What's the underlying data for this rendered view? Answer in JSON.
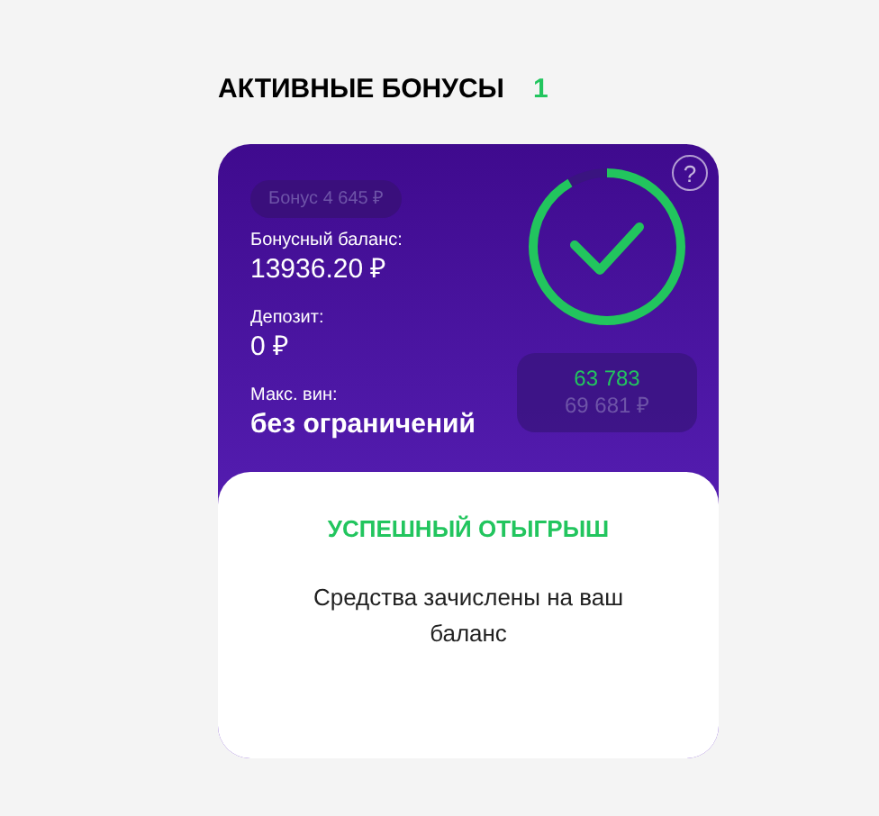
{
  "heading": {
    "title": "АКТИВНЫЕ БОНУСЫ",
    "count": "1"
  },
  "bonus_card": {
    "help": "?",
    "bonus_tag": "Бонус 4 645 ₽",
    "fields": [
      {
        "label": "Бонусный баланс:",
        "value": "13936.20 ₽"
      },
      {
        "label": "Депозит:",
        "value": "0 ₽"
      },
      {
        "label": "Макс. вин:",
        "value": "без ограничений"
      }
    ],
    "progress": {
      "level": 0.915,
      "current": "63 783",
      "target": "69 681 ₽"
    },
    "status": {
      "title": "УСПЕШНЫЙ ОТЫГРЫШ",
      "message": "Средства зачислены на ваш баланс"
    }
  }
}
